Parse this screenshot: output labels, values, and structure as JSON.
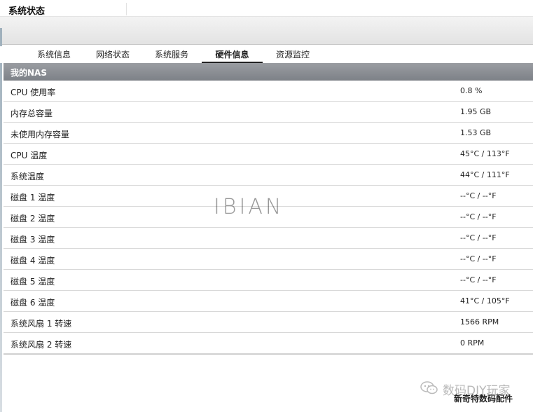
{
  "window": {
    "title": "系统状态"
  },
  "tabs": [
    {
      "label": "系统信息",
      "active": false
    },
    {
      "label": "网络状态",
      "active": false
    },
    {
      "label": "系统服务",
      "active": false
    },
    {
      "label": "硬件信息",
      "active": true
    },
    {
      "label": "资源监控",
      "active": false
    }
  ],
  "section": {
    "title": "我的NAS"
  },
  "rows": [
    {
      "label": "CPU 使用率",
      "value": "0.8 %"
    },
    {
      "label": "内存总容量",
      "value": "1.95 GB"
    },
    {
      "label": "未使用内存容量",
      "value": "1.53 GB"
    },
    {
      "label": "CPU 温度",
      "value": "45°C / 113°F"
    },
    {
      "label": "系统温度",
      "value": "44°C / 111°F"
    },
    {
      "label": "磁盘 1 温度",
      "value": "--°C / --°F"
    },
    {
      "label": "磁盘 2 温度",
      "value": "--°C / --°F"
    },
    {
      "label": "磁盘 3 温度",
      "value": "--°C / --°F"
    },
    {
      "label": "磁盘 4 温度",
      "value": "--°C / --°F"
    },
    {
      "label": "磁盘 5 温度",
      "value": "--°C / --°F"
    },
    {
      "label": "磁盘 6 温度",
      "value": "41°C / 105°F"
    },
    {
      "label": "系统风扇 1 转速",
      "value": "1566 RPM"
    },
    {
      "label": "系统风扇 2 转速",
      "value": "0 RPM"
    }
  ],
  "watermark": {
    "text": "IBIAN"
  },
  "corner": {
    "brand": "数码DIY玩家",
    "sub": "新奇特数码配件",
    "icon": "wechat-icon"
  },
  "colors": {
    "header_bg": "#8a8e93",
    "row_border": "#d8d8d8",
    "active_tab_underline": "#222222"
  }
}
